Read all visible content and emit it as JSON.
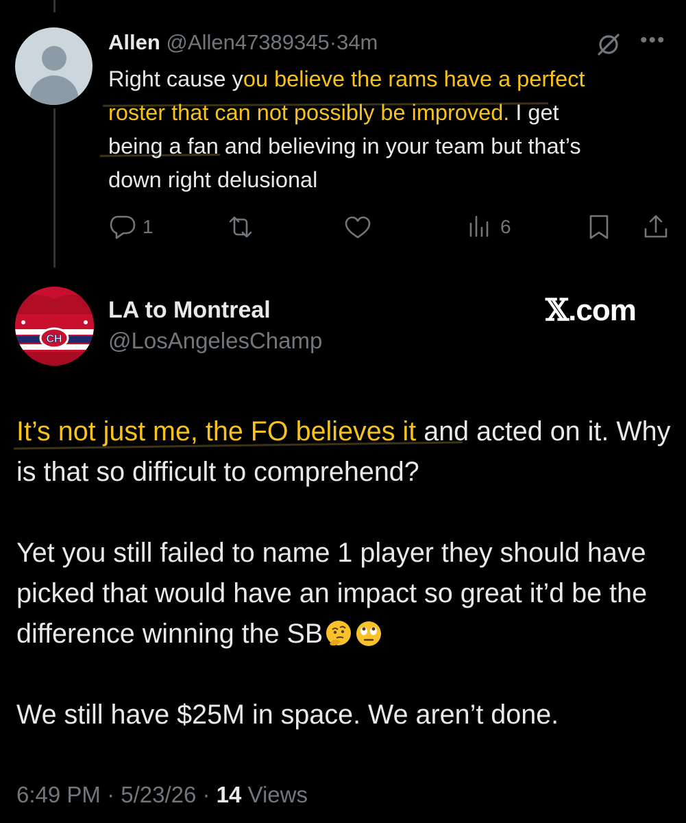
{
  "reply": {
    "name": "Allen",
    "handle": "@Allen47389345",
    "separator": "·",
    "time": "34m",
    "more_icon": "more-dots-icon",
    "grok_icon": "grok-icon",
    "text_pre": "Right cause y",
    "text_highlight": "ou believe the rams have a perfect roster that can not possibly be improved.",
    "text_post": " I get being a fan and believing in your team but that’s down right delusional",
    "highlight_color": "#f7c21a",
    "actions": {
      "replies": "1",
      "views": "6"
    }
  },
  "main": {
    "name": "LA to Montreal",
    "handle": "@LosAngelesChamp",
    "watermark_glyph": "𝕏",
    "watermark_text": ".com",
    "paragraph1_highlight": "It’s not just me, the FO believes it",
    "paragraph1_rest": " and acted on it. Why is that so difficult to comprehend?",
    "paragraph2": "Yet you still failed to name 1 player they should have picked that would have an impact so great it’d be the difference winning the SB",
    "paragraph2_emojis": [
      "thinking-face-emoji",
      "rolling-eyes-emoji"
    ],
    "paragraph3": "We still have $25M in space. We aren’t done.",
    "footer": {
      "time": "6:49 PM",
      "sep1": " · ",
      "date": "5/23/26",
      "sep2": " · ",
      "views_count": "14",
      "views_label": " Views"
    }
  }
}
